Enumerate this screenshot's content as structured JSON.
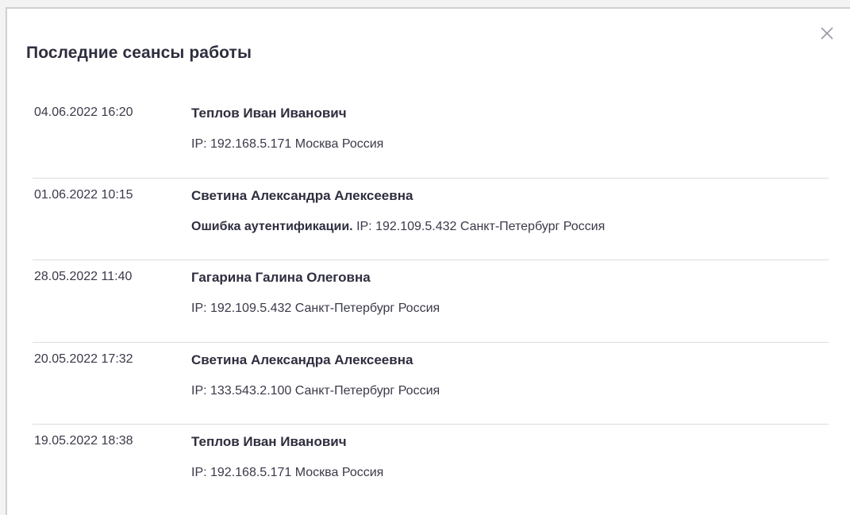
{
  "dialog": {
    "title": "Последние сеансы работы",
    "close_icon": "close-icon"
  },
  "sessions": [
    {
      "datetime": "04.06.2022 16:20",
      "user": "Теплов Иван Иванович",
      "error": "",
      "details": "IP: 192.168.5.171 Москва Россия"
    },
    {
      "datetime": "01.06.2022 10:15",
      "user": "Светина Александра Алексеевна",
      "error": "Ошибка аутентификации.",
      "details": "IP: 192.109.5.432 Санкт-Петербург Россия"
    },
    {
      "datetime": "28.05.2022 11:40",
      "user": "Гагарина Галина Олеговна",
      "error": "",
      "details": "IP: 192.109.5.432 Санкт-Петербург Россия"
    },
    {
      "datetime": "20.05.2022 17:32",
      "user": "Светина Александра Алексеевна",
      "error": "",
      "details": "IP: 133.543.2.100 Санкт-Петербург Россия"
    },
    {
      "datetime": "19.05.2022 18:38",
      "user": "Теплов Иван Иванович",
      "error": "",
      "details": "IP: 192.168.5.171 Москва Россия"
    }
  ]
}
